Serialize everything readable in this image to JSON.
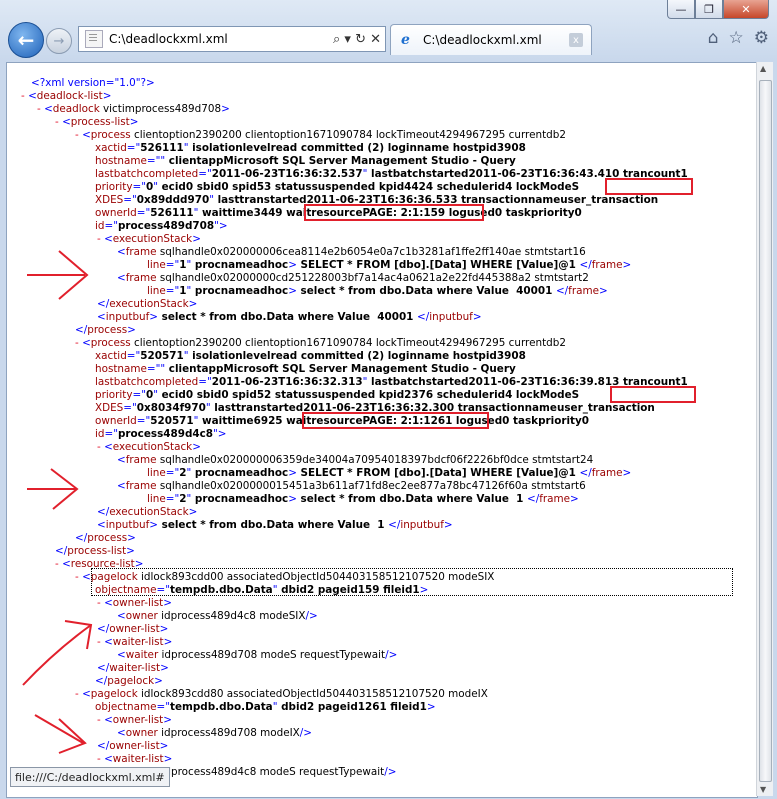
{
  "window": {
    "min": "—",
    "max": "❐",
    "close": "✕"
  },
  "nav": {
    "back_icon": "arrow-left",
    "forward_icon": "arrow-right",
    "address": "C:\\deadlockxml.xml",
    "address_tools": "⌕ ▾ ↻ ✕"
  },
  "tab": {
    "title": "C:\\deadlockxml.xml",
    "close": "x"
  },
  "tools": {
    "home": "⌂",
    "favorites": "☆",
    "settings": "⚙"
  },
  "status": {
    "text": "file:///C:/deadlockxml.xml#"
  },
  "xml_lines": [
    "<?xml version=\"1.0\"?>",
    "- <deadlock-list>",
    "- <deadlock victim=\"process489d708\">",
    "- <process-list>",
    "- <process clientoption2=\"390200\" clientoption1=\"671090784\" lockTimeout=\"4294967295\" currentdb=\"2\"",
    "xactid=\"526111\" isolationlevel=\"read committed (2)\" loginname=\"\" hostpid=\"3908\"",
    "hostname=\"\" clientapp=\"Microsoft SQL Server Management Studio - Query\"",
    "lastbatchcompleted=\"2011-06-23T16:36:32.537\" lastbatchstarted=\"2011-06-23T16:36:43.410\" trancount=\"1\"",
    "priority=\"0\" ecid=\"0\" sbid=\"0\" spid=\"53\" status=\"suspended\" kpid=\"4424\" schedulerid=\"4\" lockMode=\"S\"",
    "XDES=\"0x89ddd970\" lasttranstarted=\"2011-06-23T16:36:36.533\" transactionname=\"user_transaction\"",
    "ownerId=\"526111\" waittime=\"3449\" waitresource=\"PAGE: 2:1:159\" logused=\"0\" taskpriority=\"0\"",
    "id=\"process489d708\">",
    "- <executionStack>",
    "<frame sqlhandle=\"0x020000006cea8114e2b6054e0a7c1b3281af1ffe2ff140ae\" stmtstart=\"16\"",
    "line=\"1\" procname=\"adhoc\"> SELECT * FROM [dbo].[Data] WHERE [Value]=@1 </frame>",
    "<frame sqlhandle=\"0x02000000cd251228003bf7a14ac4a0621a2e22fd445388a2\" stmtstart=\"2\"",
    "line=\"1\" procname=\"adhoc\"> select * from dbo.Data where Value = 40001 </frame>",
    "</executionStack>",
    "<inputbuf> select * from dbo.Data where Value = 40001 </inputbuf>",
    "</process>",
    "- <process clientoption2=\"390200\" clientoption1=\"671090784\" lockTimeout=\"4294967295\" currentdb=\"2\"",
    "xactid=\"520571\" isolationlevel=\"read committed (2)\" loginname=\"\" hostpid=\"3908\"",
    "hostname=\"\" clientapp=\"Microsoft SQL Server Management Studio - Query\"",
    "lastbatchcompleted=\"2011-06-23T16:36:32.313\" lastbatchstarted=\"2011-06-23T16:36:39.813\" trancount=\"1\"",
    "priority=\"0\" ecid=\"0\" sbid=\"0\" spid=\"52\" status=\"suspended\" kpid=\"2376\" schedulerid=\"4\" lockMode=\"S\"",
    "XDES=\"0x8034f970\" lasttranstarted=\"2011-06-23T16:36:32.300\" transactionname=\"user_transaction\"",
    "ownerId=\"520571\" waittime=\"6925\" waitresource=\"PAGE: 2:1:1261\" logused=\"0\" taskpriority=\"0\"",
    "id=\"process489d4c8\">",
    "- <executionStack>",
    "<frame sqlhandle=\"0x020000006359de34004a70954018397bdcf06f2226bf0dce\" stmtstart=\"24\"",
    "line=\"2\" procname=\"adhoc\"> SELECT * FROM [dbo].[Data] WHERE [Value]=@1 </frame>",
    "<frame sqlhandle=\"0x0200000015451a3b611af71fd8ec2ee877a78bc47126f60a\" stmtstart=\"6\"",
    "line=\"2\" procname=\"adhoc\"> select * from dbo.Data where Value = 1 </frame>",
    "</executionStack>",
    "<inputbuf> select * from dbo.Data where Value = 1 </inputbuf>",
    "</process>",
    "</process-list>",
    "- <resource-list>",
    "- <pagelock id=\"lock893cdd00\" associatedObjectId=\"504403158512107520\" mode=\"SIX\"",
    "objectname=\"tempdb.dbo.Data\" dbid=\"2\" pageid=\"159\" fileid=\"1\">",
    "- <owner-list>",
    "<owner id=\"process489d4c8\" mode=\"SIX\"/>",
    "</owner-list>",
    "- <waiter-list>",
    "<waiter id=\"process489d708\" mode=\"S\" requestType=\"wait\"/>",
    "</waiter-list>",
    "</pagelock>",
    "- <pagelock id=\"lock893cdd80\" associatedObjectId=\"504403158512107520\" mode=\"IX\"",
    "objectname=\"tempdb.dbo.Data\" dbid=\"2\" pageid=\"1261\" fileid=\"1\">",
    "- <owner-list>",
    "<owner id=\"process489d708\" mode=\"IX\"/>",
    "</owner-list>",
    "- <waiter-list>",
    "<waiter id=\"process489d4c8\" mode=\"S\" requestType=\"wait\"/>"
  ]
}
